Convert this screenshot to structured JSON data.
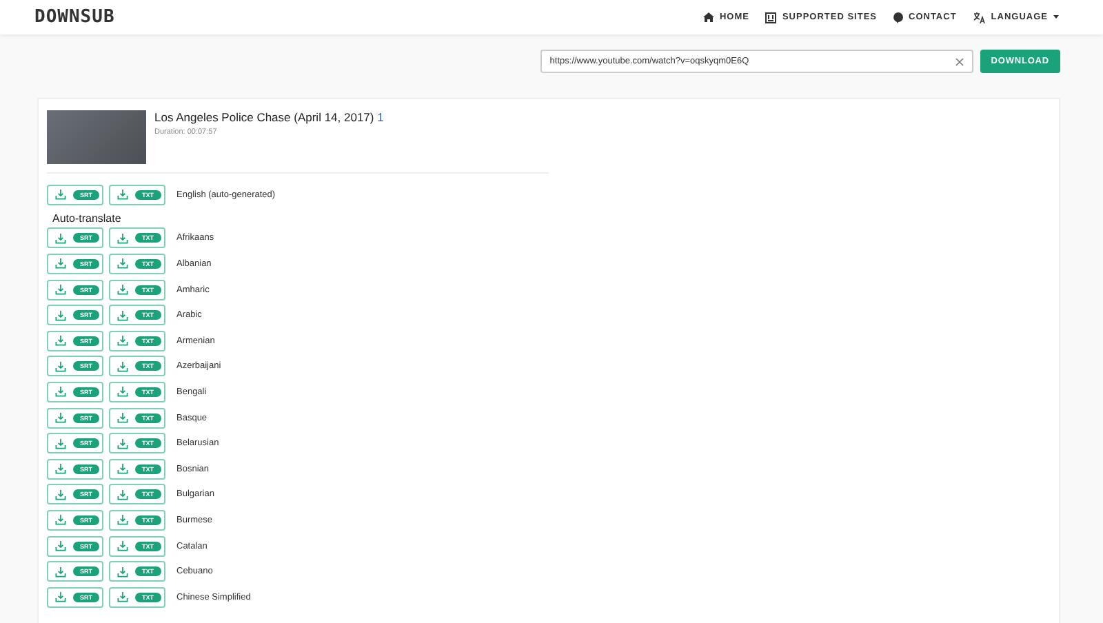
{
  "header": {
    "logo": "DOWNSUB",
    "nav": [
      {
        "kind": "home",
        "label": "HOME"
      },
      {
        "kind": "sites",
        "label": "SUPPORTED SITES"
      },
      {
        "kind": "contact",
        "label": "CONTACT"
      },
      {
        "kind": "language",
        "label": "LANGUAGE"
      }
    ]
  },
  "search": {
    "value": "https://www.youtube.com/watch?v=oqskyqm0E6Q",
    "button": "DOWNLOAD"
  },
  "video": {
    "title": "Los Angeles Police Chase (April 14, 2017)",
    "count": "1",
    "duration": "Duration: 00:07:57"
  },
  "original": {
    "srt": "SRT",
    "txt": "TXT",
    "language": "English (auto-generated)"
  },
  "auto_translate": {
    "heading": "Auto-translate",
    "languages": [
      {
        "srt": "SRT",
        "txt": "TXT",
        "name": "Afrikaans"
      },
      {
        "srt": "SRT",
        "txt": "TXT",
        "name": "Albanian"
      },
      {
        "srt": "SRT",
        "txt": "TXT",
        "name": "Amharic"
      },
      {
        "srt": "SRT",
        "txt": "TXT",
        "name": "Arabic"
      },
      {
        "srt": "SRT",
        "txt": "TXT",
        "name": "Armenian"
      },
      {
        "srt": "SRT",
        "txt": "TXT",
        "name": "Azerbaijani"
      },
      {
        "srt": "SRT",
        "txt": "TXT",
        "name": "Bengali"
      },
      {
        "srt": "SRT",
        "txt": "TXT",
        "name": "Basque"
      },
      {
        "srt": "SRT",
        "txt": "TXT",
        "name": "Belarusian"
      },
      {
        "srt": "SRT",
        "txt": "TXT",
        "name": "Bosnian"
      },
      {
        "srt": "SRT",
        "txt": "TXT",
        "name": "Bulgarian"
      },
      {
        "srt": "SRT",
        "txt": "TXT",
        "name": "Burmese"
      },
      {
        "srt": "SRT",
        "txt": "TXT",
        "name": "Catalan"
      },
      {
        "srt": "SRT",
        "txt": "TXT",
        "name": "Cebuano"
      },
      {
        "srt": "SRT",
        "txt": "TXT",
        "name": "Chinese Simplified"
      }
    ]
  }
}
